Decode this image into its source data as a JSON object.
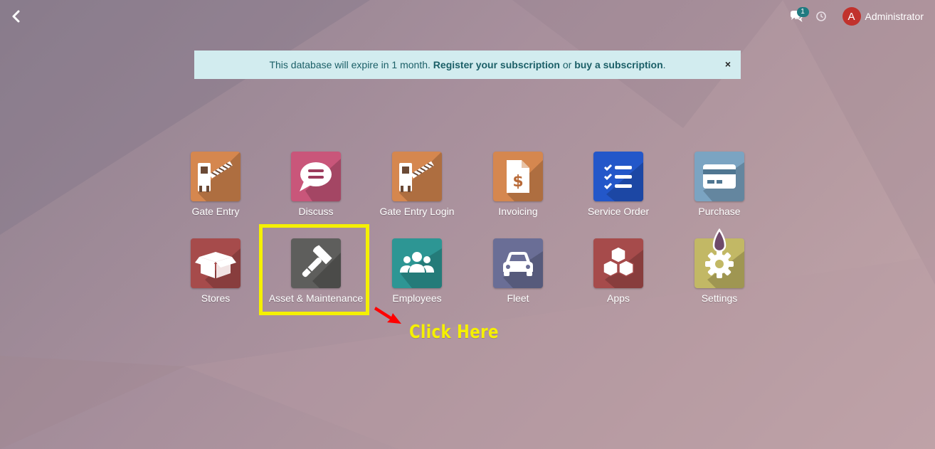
{
  "header": {
    "back_icon": "chevron-left-icon",
    "chat_icon": "comments-icon",
    "chat_count": "1",
    "clock_icon": "clock-icon",
    "user": {
      "initial": "A",
      "name": "Administrator",
      "avatar_color": "#c1322d"
    }
  },
  "alert": {
    "text_before": "This database will expire in 1 month.",
    "register_link": "Register your subscription",
    "text_or": "or",
    "buy_link": "buy a subscription",
    "text_after": ".",
    "close": "×"
  },
  "apps": [
    {
      "label": "Gate Entry",
      "icon": "gate-barrier-icon",
      "color": "#d5874f"
    },
    {
      "label": "Discuss",
      "icon": "chat-bubble-icon",
      "color": "#c9567a"
    },
    {
      "label": "Gate Entry Login",
      "icon": "gate-barrier-icon",
      "color": "#d5874f"
    },
    {
      "label": "Invoicing",
      "icon": "invoice-dollar-icon",
      "color": "#d5874f"
    },
    {
      "label": "Service Order",
      "icon": "checklist-icon",
      "color": "#2357c9"
    },
    {
      "label": "Purchase",
      "icon": "credit-card-icon",
      "color": "#7ba4c2"
    },
    {
      "label": "Stores",
      "icon": "open-box-icon",
      "color": "#a64b4b"
    },
    {
      "label": "Asset & Maintenance",
      "icon": "hammer-icon",
      "color": "#5e5e5c"
    },
    {
      "label": "Employees",
      "icon": "users-group-icon",
      "color": "#2d9694"
    },
    {
      "label": "Fleet",
      "icon": "car-icon",
      "color": "#6a6e96"
    },
    {
      "label": "Apps",
      "icon": "cubes-icon",
      "color": "#a64b4b"
    },
    {
      "label": "Settings",
      "icon": "gear-icon",
      "color": "#c2b865"
    }
  ],
  "annotation": {
    "text": "Click Here",
    "color": "#f5f000",
    "arrow_color": "#ff0000"
  }
}
